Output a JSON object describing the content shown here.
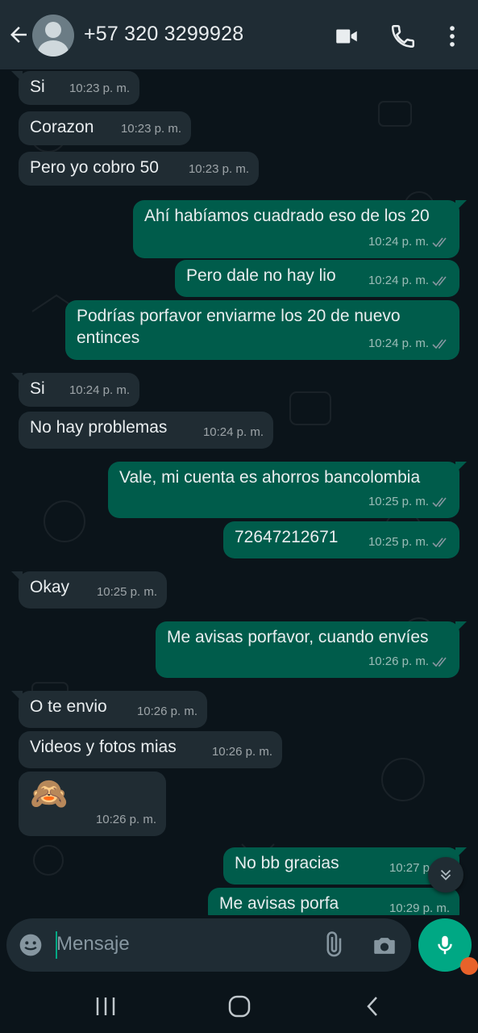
{
  "header": {
    "contact_name": "+57 320 3299928",
    "icons": [
      "back-arrow-icon",
      "avatar",
      "video-call-icon",
      "phone-icon",
      "more-options-icon"
    ]
  },
  "messages": [
    {
      "dir": "in",
      "text": "Si",
      "time": "10:23 p. m."
    },
    {
      "dir": "in",
      "text": "Corazon",
      "time": "10:23 p. m."
    },
    {
      "dir": "in",
      "text": "Pero yo cobro 50",
      "time": "10:23 p. m."
    },
    {
      "dir": "out",
      "text": "Ahí habíamos cuadrado eso de los 20",
      "time": "10:24 p. m."
    },
    {
      "dir": "out",
      "text": "Pero dale no hay lio",
      "time": "10:24 p. m."
    },
    {
      "dir": "out",
      "text": "Podrías porfavor enviarme los 20 de nuevo entinces",
      "time": "10:24 p. m."
    },
    {
      "dir": "in",
      "text": "Si",
      "time": "10:24 p. m."
    },
    {
      "dir": "in",
      "text": "No hay problemas",
      "time": "10:24 p. m."
    },
    {
      "dir": "out",
      "text": "Vale, mi cuenta es ahorros bancolombia",
      "time": "10:25 p. m."
    },
    {
      "dir": "out",
      "text": "72647212671",
      "time": "10:25 p. m."
    },
    {
      "dir": "in",
      "text": "Okay",
      "time": "10:25 p. m."
    },
    {
      "dir": "out",
      "text": "Me avisas porfavor, cuando envíes",
      "time": "10:26 p. m."
    },
    {
      "dir": "in",
      "text": "O te envio",
      "time": "10:26 p. m."
    },
    {
      "dir": "in",
      "text": "Videos y fotos mias",
      "time": "10:26 p. m."
    },
    {
      "dir": "in",
      "text": "🙈",
      "time": "10:26 p. m."
    },
    {
      "dir": "out",
      "text": "No bb gracias",
      "time": "10:27 p. m."
    },
    {
      "dir": "out",
      "text": "Me avisas porfa",
      "time": "10:29 p. m."
    }
  ],
  "input": {
    "placeholder": "Mensaje"
  },
  "colors": {
    "header_bg": "#1f2c34",
    "chat_bg": "#0b141a",
    "incoming_bubble": "#202c33",
    "outgoing_bubble": "#005c4b",
    "accent": "#00a884",
    "read_ticks": "#8696a0"
  }
}
